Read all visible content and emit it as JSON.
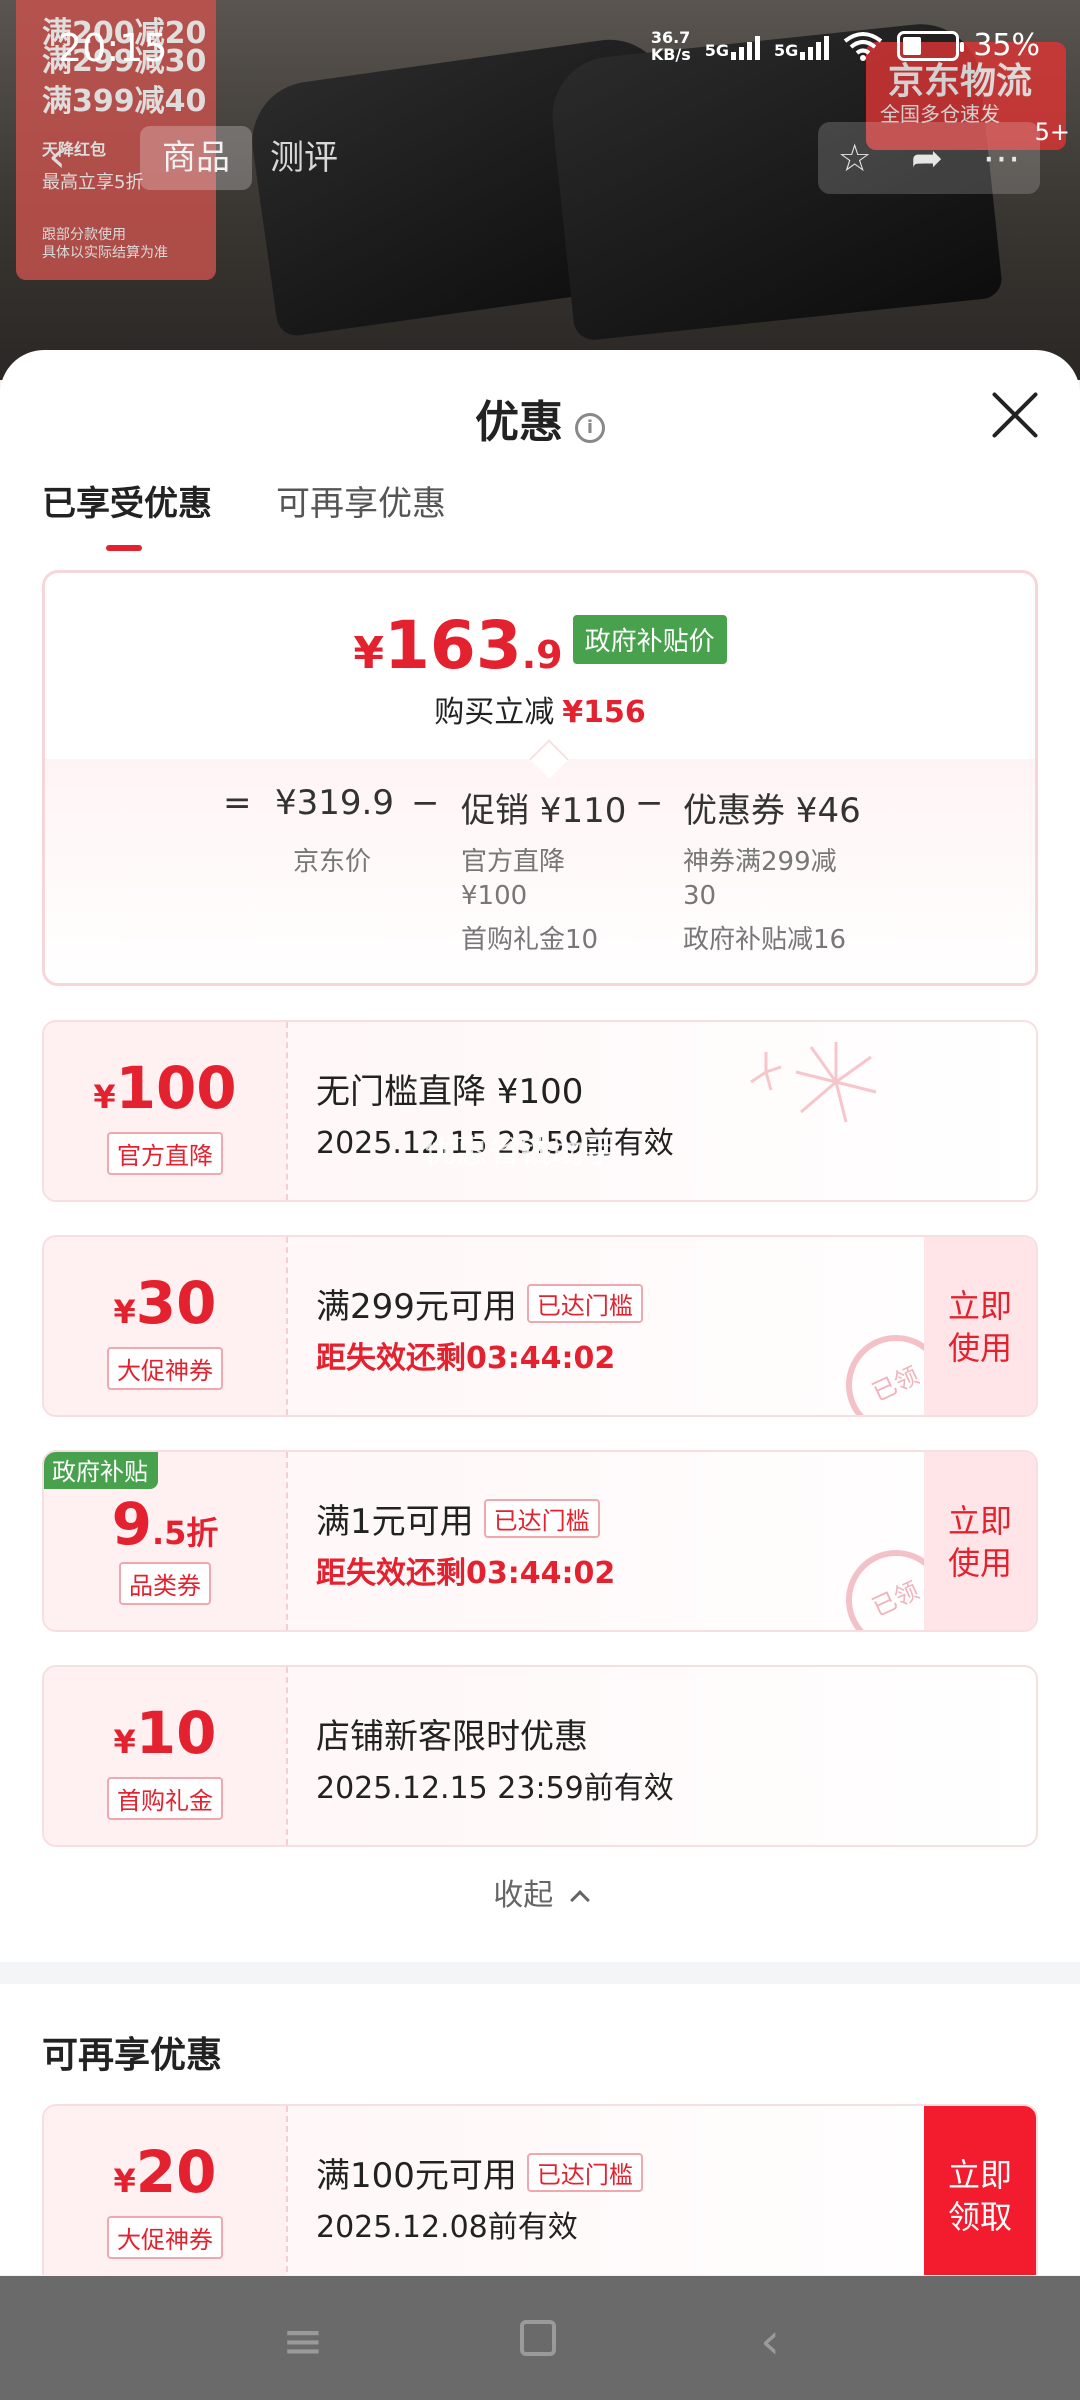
{
  "status_bar": {
    "time": "20:15",
    "speed": "36.7\nKB/s",
    "net1": "5G",
    "net2": "5G",
    "battery": "35%",
    "battery_level": 0.35
  },
  "background": {
    "promo_lines": [
      "满200减20",
      "满299减30",
      "满399减40"
    ],
    "promo_note": "天降红包",
    "promo_sub": "最高立享5折",
    "promo_foot": "跟部分款使用\n具体以实际结算为准",
    "jd_logistics": "京东物流",
    "jd_sub": "全国多仓速发",
    "badge_count": "5+"
  },
  "top_nav": {
    "tabs": [
      "商品",
      "测评"
    ]
  },
  "sheet": {
    "title": "优惠",
    "tabs": [
      "已享受优惠",
      "可再享优惠"
    ],
    "summary": {
      "currency": "¥",
      "price_int": "163",
      "price_dec": ".9",
      "price_tag": "政府补贴价",
      "reduce_label": "购买立减",
      "reduce_value": "¥156",
      "eq": "=",
      "jd_price": "¥319.9",
      "minus": "−",
      "promo": "促销 ¥110",
      "coupon": "优惠券 ¥46",
      "jd_price_label": "京东价",
      "promo_lines": [
        "官方直降",
        "¥100",
        "首购礼金10"
      ],
      "coupon_lines": [
        "神券满299减",
        "30",
        "政府补贴减16"
      ]
    },
    "coupons": [
      {
        "symbol": "¥",
        "amount": "100",
        "kind": "官方直降",
        "title": "无门槛直降 ¥100",
        "sub": "2025.12.15 23:59前有效",
        "watermark": "优惠省钱助手"
      },
      {
        "symbol": "¥",
        "amount": "30",
        "kind": "大促神券",
        "title": "满299元可用",
        "tag": "已达门槛",
        "sub": "距失效还剩03:44:02",
        "action": "立即\n使用",
        "stamp": "已领"
      },
      {
        "gov": "政府补贴",
        "amount": "9",
        "unit": ".5折",
        "kind": "品类券",
        "title": "满1元可用",
        "tag": "已达门槛",
        "sub": "距失效还剩03:44:02",
        "action": "立即\n使用",
        "stamp": "已领"
      },
      {
        "symbol": "¥",
        "amount": "10",
        "kind": "首购礼金",
        "title": "店铺新客限时优惠",
        "sub": "2025.12.15 23:59前有效"
      }
    ],
    "collapse": "收起",
    "more_title": "可再享优惠",
    "more_coupon": {
      "symbol": "¥",
      "amount": "20",
      "kind": "大促神券",
      "title": "满100元可用",
      "tag": "已达门槛",
      "sub": "2025.12.08前有效",
      "action": "立即\n领取"
    }
  },
  "colors": {
    "accent": "#e4222f",
    "gov_green": "#48a14d"
  }
}
